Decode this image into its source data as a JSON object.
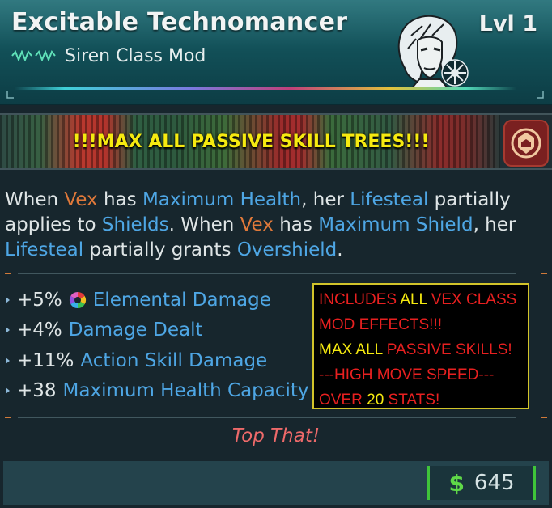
{
  "item": {
    "title": "Excitable Technomancer",
    "level": "Lvl 1",
    "class_mod": "Siren Class Mod",
    "flavor_text": "Top That!",
    "price": "645",
    "currency_symbol": "$"
  },
  "banner": {
    "text": "!!!MAX ALL PASSIVE SKILL TREES!!!"
  },
  "description": {
    "s1_a": "When ",
    "s1_name": "Vex",
    "s1_b": " has ",
    "s1_stat": "Maximum Health",
    "s1_c": ", her ",
    "s1_lifesteal": "Lifesteal",
    "s1_d": " partially applies to ",
    "s1_shields": "Shields",
    "s1_e": ".",
    "s2_a": " When ",
    "s2_name": "Vex",
    "s2_b": " has ",
    "s2_stat": "Maximum Shield",
    "s2_c": ", her ",
    "s2_lifesteal": "Lifesteal",
    "s2_d": " partially grants ",
    "s2_overshield": "Overshield",
    "s2_e": "."
  },
  "stats": [
    {
      "value": "+5%",
      "name": "Elemental Damage",
      "icon": "elemental-icon"
    },
    {
      "value": "+4%",
      "name": "Damage Dealt"
    },
    {
      "value": "+11%",
      "name": "Action Skill Damage"
    },
    {
      "value": "+38",
      "name": "Maximum Health Capacity"
    }
  ],
  "note": {
    "l1_a": "INCLUDES ",
    "l1_b": "ALL",
    "l1_c": " VEX CLASS",
    "l2": "MOD EFFECTS!!!",
    "l3_a": "MAX ALL ",
    "l3_b": "PASSIVE SKILLS!",
    "l4": "---HIGH MOVE SPEED---",
    "l5_a": "OVER ",
    "l5_b": "20",
    "l5_c": " STATS!"
  },
  "colors": {
    "header_teal": "#125159",
    "stat_blue": "#4ea6e4",
    "name_orange": "#e0793a",
    "banner_yellow": "#f6ea10",
    "note_red": "#e82020",
    "price_green": "#5fd848",
    "flavor_red": "#ee6a6a"
  }
}
